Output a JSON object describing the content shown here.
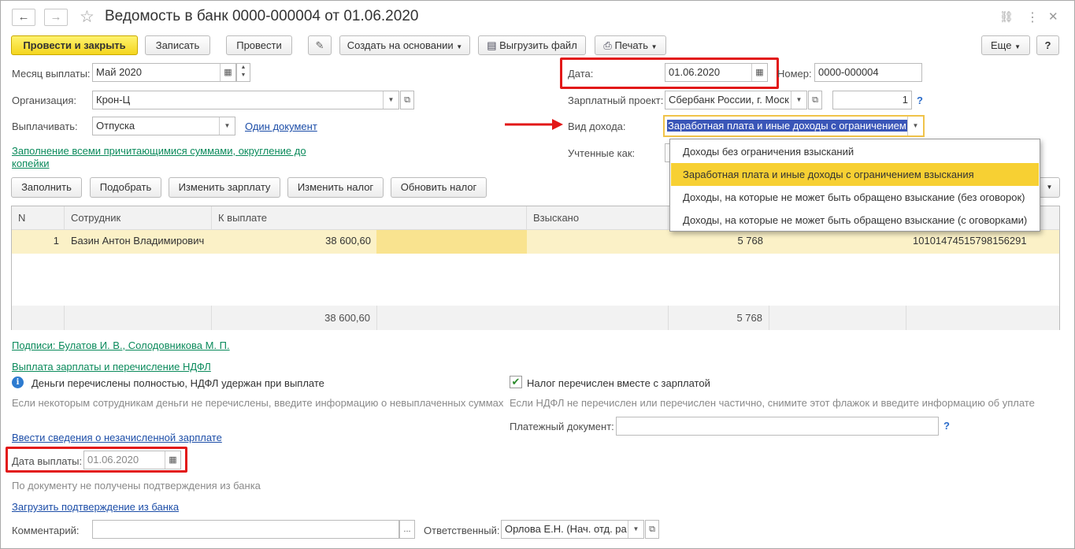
{
  "window": {
    "title": "Ведомость в банк 0000-000004 от 01.06.2020",
    "back_icon": "←",
    "forward_icon": "→",
    "star_icon": "☆",
    "link_icon": "🔗",
    "menu_icon": "⋮",
    "close_icon": "✕"
  },
  "toolbar": {
    "post_close": "Провести и закрыть",
    "save": "Записать",
    "post": "Провести",
    "clip_icon": "📎",
    "create_based": "Создать на основании",
    "upload": "Выгрузить файл",
    "print": "Печать",
    "more": "Еще",
    "help": "?"
  },
  "form": {
    "month_label": "Месяц выплаты:",
    "month_value": "Май 2020",
    "org_label": "Организация:",
    "org_value": "Крон-Ц",
    "pay_label": "Выплачивать:",
    "pay_value": "Отпуска",
    "one_doc_link": "Один документ",
    "fill_link": "Заполнение всеми причитающимися суммами, округление до копейки",
    "date_label": "Дата:",
    "date_value": "01.06.2020",
    "number_label": "Номер:",
    "number_value": "0000-000004",
    "project_label": "Зарплатный проект:",
    "project_value": "Сбербанк России, г. Моск",
    "project_count": "1",
    "project_help": "?",
    "income_label": "Вид дохода:",
    "income_value": "Заработная плата и иные доходы с ограничением",
    "counted_label": "Учтенные как:"
  },
  "income_dropdown": {
    "options": [
      "Доходы без ограничения взысканий",
      "Заработная плата и иные доходы с ограничением взыскания",
      "Доходы, на которые не может быть обращено взыскание (без оговорок)",
      "Доходы, на которые не может быть обращено взыскание (с оговорками)"
    ],
    "selected_index": 1
  },
  "table_toolbar": {
    "fill": "Заполнить",
    "pick": "Подобрать",
    "change_salary": "Изменить зарплату",
    "change_tax": "Изменить налог",
    "refresh_tax": "Обновить налог"
  },
  "table": {
    "headers": {
      "n": "N",
      "employee": "Сотрудник",
      "to_pay": "К выплате",
      "withheld": "Взыскано"
    },
    "rows": [
      {
        "n": "1",
        "employee": "Базин Антон Владимирович",
        "to_pay": "38 600,60",
        "tax": "5 768",
        "account": "10101474515798156291"
      }
    ],
    "footer": {
      "to_pay": "38 600,60",
      "tax": "5 768"
    }
  },
  "signatures_link": "Подписи: Булатов И. В., Солодовникова М. П.",
  "payout_link": "Выплата зарплаты и перечисление НДФЛ",
  "info_text": "Деньги перечислены  полностью, НДФЛ удержан при выплате",
  "info_hint": "Если некоторым сотрудникам деньги не перечислены, введите информацию о невыплаченных суммах",
  "tax_checkbox_label": "Налог перечислен вместе с зарплатой",
  "tax_hint": "Если НДФЛ не перечислен или перечислен частично, снимите этот флажок и введите информацию об уплате",
  "payment_doc_label": "Платежный документ:",
  "payment_doc_help": "?",
  "unpaid_link": "Ввести сведения о незачисленной зарплате",
  "pay_date_label": "Дата выплаты:",
  "pay_date_value": "01.06.2020",
  "bank_status": "По документу не получены подтверждения из банка",
  "load_confirm_link": "Загрузить подтверждение из банка",
  "comment_label": "Комментарий:",
  "comment_btn": "...",
  "responsible_label": "Ответственный:",
  "responsible_value": "Орлова Е.Н. (Нач. отд. ра"
}
